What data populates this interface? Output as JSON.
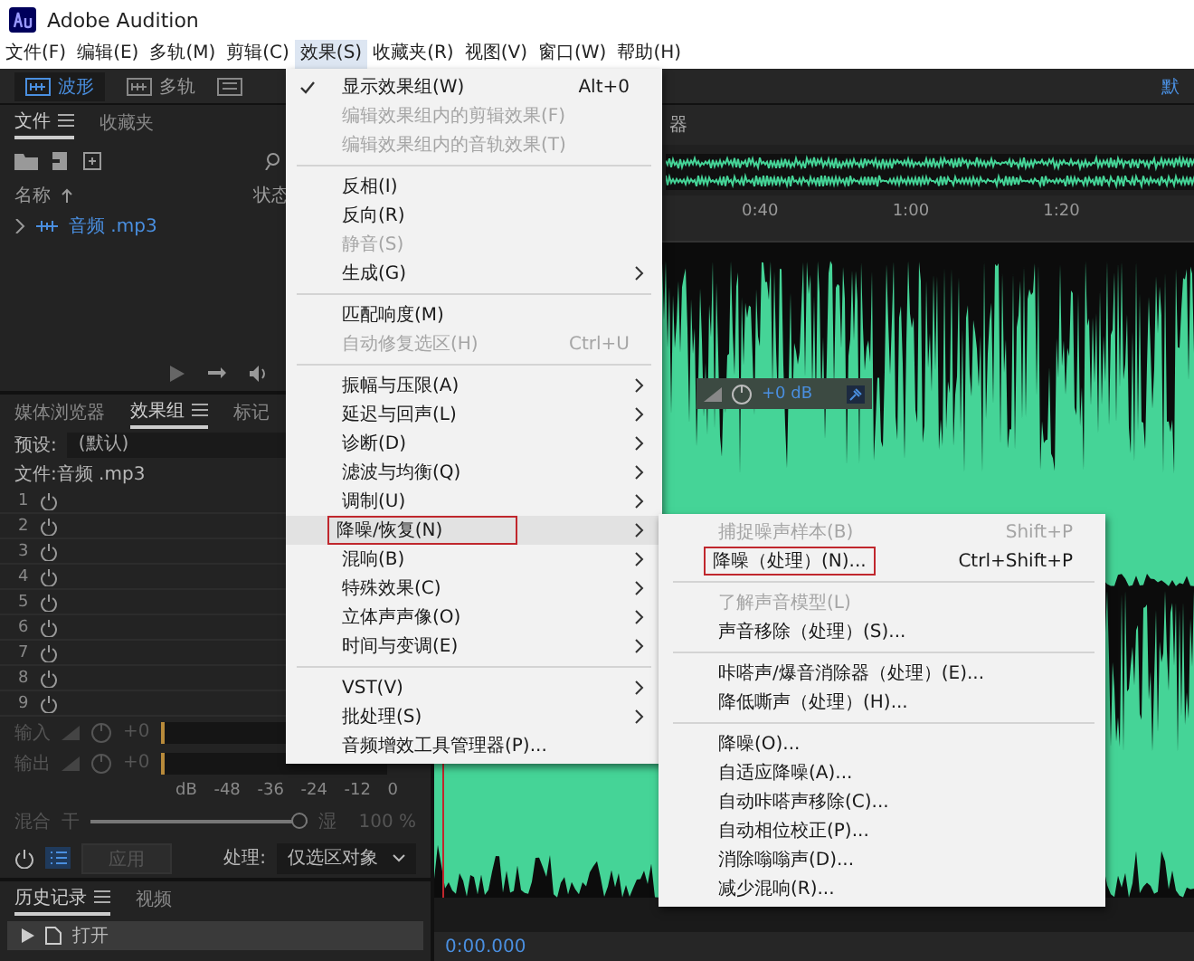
{
  "window": {
    "title": "Adobe Audition"
  },
  "menu_bar": [
    {
      "label": "文件(F)",
      "selected": false
    },
    {
      "label": "编辑(E)",
      "selected": false
    },
    {
      "label": "多轨(M)",
      "selected": false
    },
    {
      "label": "剪辑(C)",
      "selected": false
    },
    {
      "label": "效果(S)",
      "selected": true
    },
    {
      "label": "收藏夹(R)",
      "selected": false
    },
    {
      "label": "视图(V)",
      "selected": false
    },
    {
      "label": "窗口(W)",
      "selected": false
    },
    {
      "label": "帮助(H)",
      "selected": false
    }
  ],
  "toolbar": {
    "modes": [
      {
        "label": "波形",
        "selected": true
      },
      {
        "label": "多轨",
        "selected": false
      }
    ],
    "workspace": "默"
  },
  "files_panel": {
    "tabs": [
      {
        "label": "文件",
        "selected": true
      },
      {
        "label": "收藏夹",
        "selected": false
      }
    ],
    "columns": [
      "名称",
      "状态"
    ],
    "files": [
      {
        "name": "音频 .mp3",
        "expanded": false
      }
    ]
  },
  "effects_panel": {
    "tabs": [
      {
        "label": "媒体浏览器",
        "selected": false
      },
      {
        "label": "效果组",
        "selected": true
      },
      {
        "label": "标记",
        "selected": false
      }
    ],
    "preset_label": "预设:",
    "preset": "(默认)",
    "file": "文件:音频 .mp3",
    "slots": [
      "1",
      "2",
      "3",
      "4",
      "5",
      "6",
      "7",
      "8",
      "9"
    ],
    "input": {
      "label": "输入",
      "value": "+0"
    },
    "output": {
      "label": "输出",
      "value": "+0"
    },
    "meter_scale": [
      "dB",
      "-48",
      "-36",
      "-24",
      "-12",
      "0"
    ],
    "mix": {
      "label": "混合",
      "dry": "干",
      "wet": "湿",
      "level": 0.96,
      "value": "100 %"
    },
    "apply_button": {
      "label": "应用",
      "disabled": true
    },
    "process_label": "处理:",
    "process_value": "仅选区对象"
  },
  "history_panel": {
    "tabs": [
      {
        "label": "历史记录",
        "selected": true
      },
      {
        "label": "视频",
        "selected": false
      }
    ],
    "items": [
      {
        "label": "打开"
      }
    ]
  },
  "editor": {
    "tab": "器",
    "ruler": [
      "0:40",
      "1:00",
      "1:20"
    ],
    "hud": {
      "value": "+0 dB"
    },
    "time": "0:00.000"
  },
  "effects_menu": {
    "groups": [
      [
        {
          "label": "显示效果组(W)",
          "shortcut": "Alt+0",
          "checked": true,
          "disabled": false,
          "submenu": false,
          "selected": false,
          "outlined": false
        },
        {
          "label": "编辑效果组内的剪辑效果(F)",
          "checked": false,
          "disabled": true,
          "submenu": false,
          "selected": false,
          "outlined": false
        },
        {
          "label": "编辑效果组内的音轨效果(T)",
          "checked": false,
          "disabled": true,
          "submenu": false,
          "selected": false,
          "outlined": false
        }
      ],
      [
        {
          "label": "反相(I)",
          "checked": false,
          "disabled": false,
          "submenu": false,
          "selected": false,
          "outlined": false
        },
        {
          "label": "反向(R)",
          "checked": false,
          "disabled": false,
          "submenu": false,
          "selected": false,
          "outlined": false
        },
        {
          "label": "静音(S)",
          "checked": false,
          "disabled": true,
          "submenu": false,
          "selected": false,
          "outlined": false
        },
        {
          "label": "生成(G)",
          "checked": false,
          "disabled": false,
          "submenu": true,
          "selected": false,
          "outlined": false
        }
      ],
      [
        {
          "label": "匹配响度(M)",
          "checked": false,
          "disabled": false,
          "submenu": false,
          "selected": false,
          "outlined": false
        },
        {
          "label": "自动修复选区(H)",
          "shortcut": "Ctrl+U",
          "checked": false,
          "disabled": true,
          "submenu": false,
          "selected": false,
          "outlined": false
        }
      ],
      [
        {
          "label": "振幅与压限(A)",
          "checked": false,
          "disabled": false,
          "submenu": true,
          "selected": false,
          "outlined": false
        },
        {
          "label": "延迟与回声(L)",
          "checked": false,
          "disabled": false,
          "submenu": true,
          "selected": false,
          "outlined": false
        },
        {
          "label": "诊断(D)",
          "checked": false,
          "disabled": false,
          "submenu": true,
          "selected": false,
          "outlined": false
        },
        {
          "label": "滤波与均衡(Q)",
          "checked": false,
          "disabled": false,
          "submenu": true,
          "selected": false,
          "outlined": false
        },
        {
          "label": "调制(U)",
          "checked": false,
          "disabled": false,
          "submenu": true,
          "selected": false,
          "outlined": false
        },
        {
          "label": "降噪/恢复(N)",
          "checked": false,
          "disabled": false,
          "submenu": true,
          "selected": true,
          "outlined": true
        },
        {
          "label": "混响(B)",
          "checked": false,
          "disabled": false,
          "submenu": true,
          "selected": false,
          "outlined": false
        },
        {
          "label": "特殊效果(C)",
          "checked": false,
          "disabled": false,
          "submenu": true,
          "selected": false,
          "outlined": false
        },
        {
          "label": "立体声声像(O)",
          "checked": false,
          "disabled": false,
          "submenu": true,
          "selected": false,
          "outlined": false
        },
        {
          "label": "时间与变调(E)",
          "checked": false,
          "disabled": false,
          "submenu": true,
          "selected": false,
          "outlined": false
        }
      ],
      [
        {
          "label": "VST(V)",
          "checked": false,
          "disabled": false,
          "submenu": true,
          "selected": false,
          "outlined": false
        },
        {
          "label": "批处理(S)",
          "checked": false,
          "disabled": false,
          "submenu": true,
          "selected": false,
          "outlined": false
        },
        {
          "label": "音频增效工具管理器(P)...",
          "checked": false,
          "disabled": false,
          "submenu": false,
          "selected": false,
          "outlined": false
        }
      ]
    ]
  },
  "noise_submenu": {
    "groups": [
      [
        {
          "label": "捕捉噪声样本(B)",
          "shortcut": "Shift+P",
          "checked": false,
          "disabled": true,
          "submenu": false,
          "selected": false,
          "outlined": false
        },
        {
          "label": "降噪（处理）(N)...",
          "shortcut": "Ctrl+Shift+P",
          "checked": false,
          "disabled": false,
          "submenu": false,
          "selected": false,
          "outlined": true
        }
      ],
      [
        {
          "label": "了解声音模型(L)",
          "checked": false,
          "disabled": true,
          "submenu": false,
          "selected": false,
          "outlined": false
        },
        {
          "label": "声音移除（处理）(S)...",
          "checked": false,
          "disabled": false,
          "submenu": false,
          "selected": false,
          "outlined": false
        }
      ],
      [
        {
          "label": "咔嗒声/爆音消除器（处理）(E)...",
          "checked": false,
          "disabled": false,
          "submenu": false,
          "selected": false,
          "outlined": false
        },
        {
          "label": "降低嘶声（处理）(H)...",
          "checked": false,
          "disabled": false,
          "submenu": false,
          "selected": false,
          "outlined": false
        }
      ],
      [
        {
          "label": "降噪(O)...",
          "checked": false,
          "disabled": false,
          "submenu": false,
          "selected": false,
          "outlined": false
        },
        {
          "label": "自适应降噪(A)...",
          "checked": false,
          "disabled": false,
          "submenu": false,
          "selected": false,
          "outlined": false
        },
        {
          "label": "自动咔嗒声移除(C)...",
          "checked": false,
          "disabled": false,
          "submenu": false,
          "selected": false,
          "outlined": false
        },
        {
          "label": "自动相位校正(P)...",
          "checked": false,
          "disabled": false,
          "submenu": false,
          "selected": false,
          "outlined": false
        },
        {
          "label": "消除嗡嗡声(D)...",
          "checked": false,
          "disabled": false,
          "submenu": false,
          "selected": false,
          "outlined": false
        },
        {
          "label": "减少混响(R)...",
          "checked": false,
          "disabled": false,
          "submenu": false,
          "selected": false,
          "outlined": false
        }
      ]
    ]
  }
}
